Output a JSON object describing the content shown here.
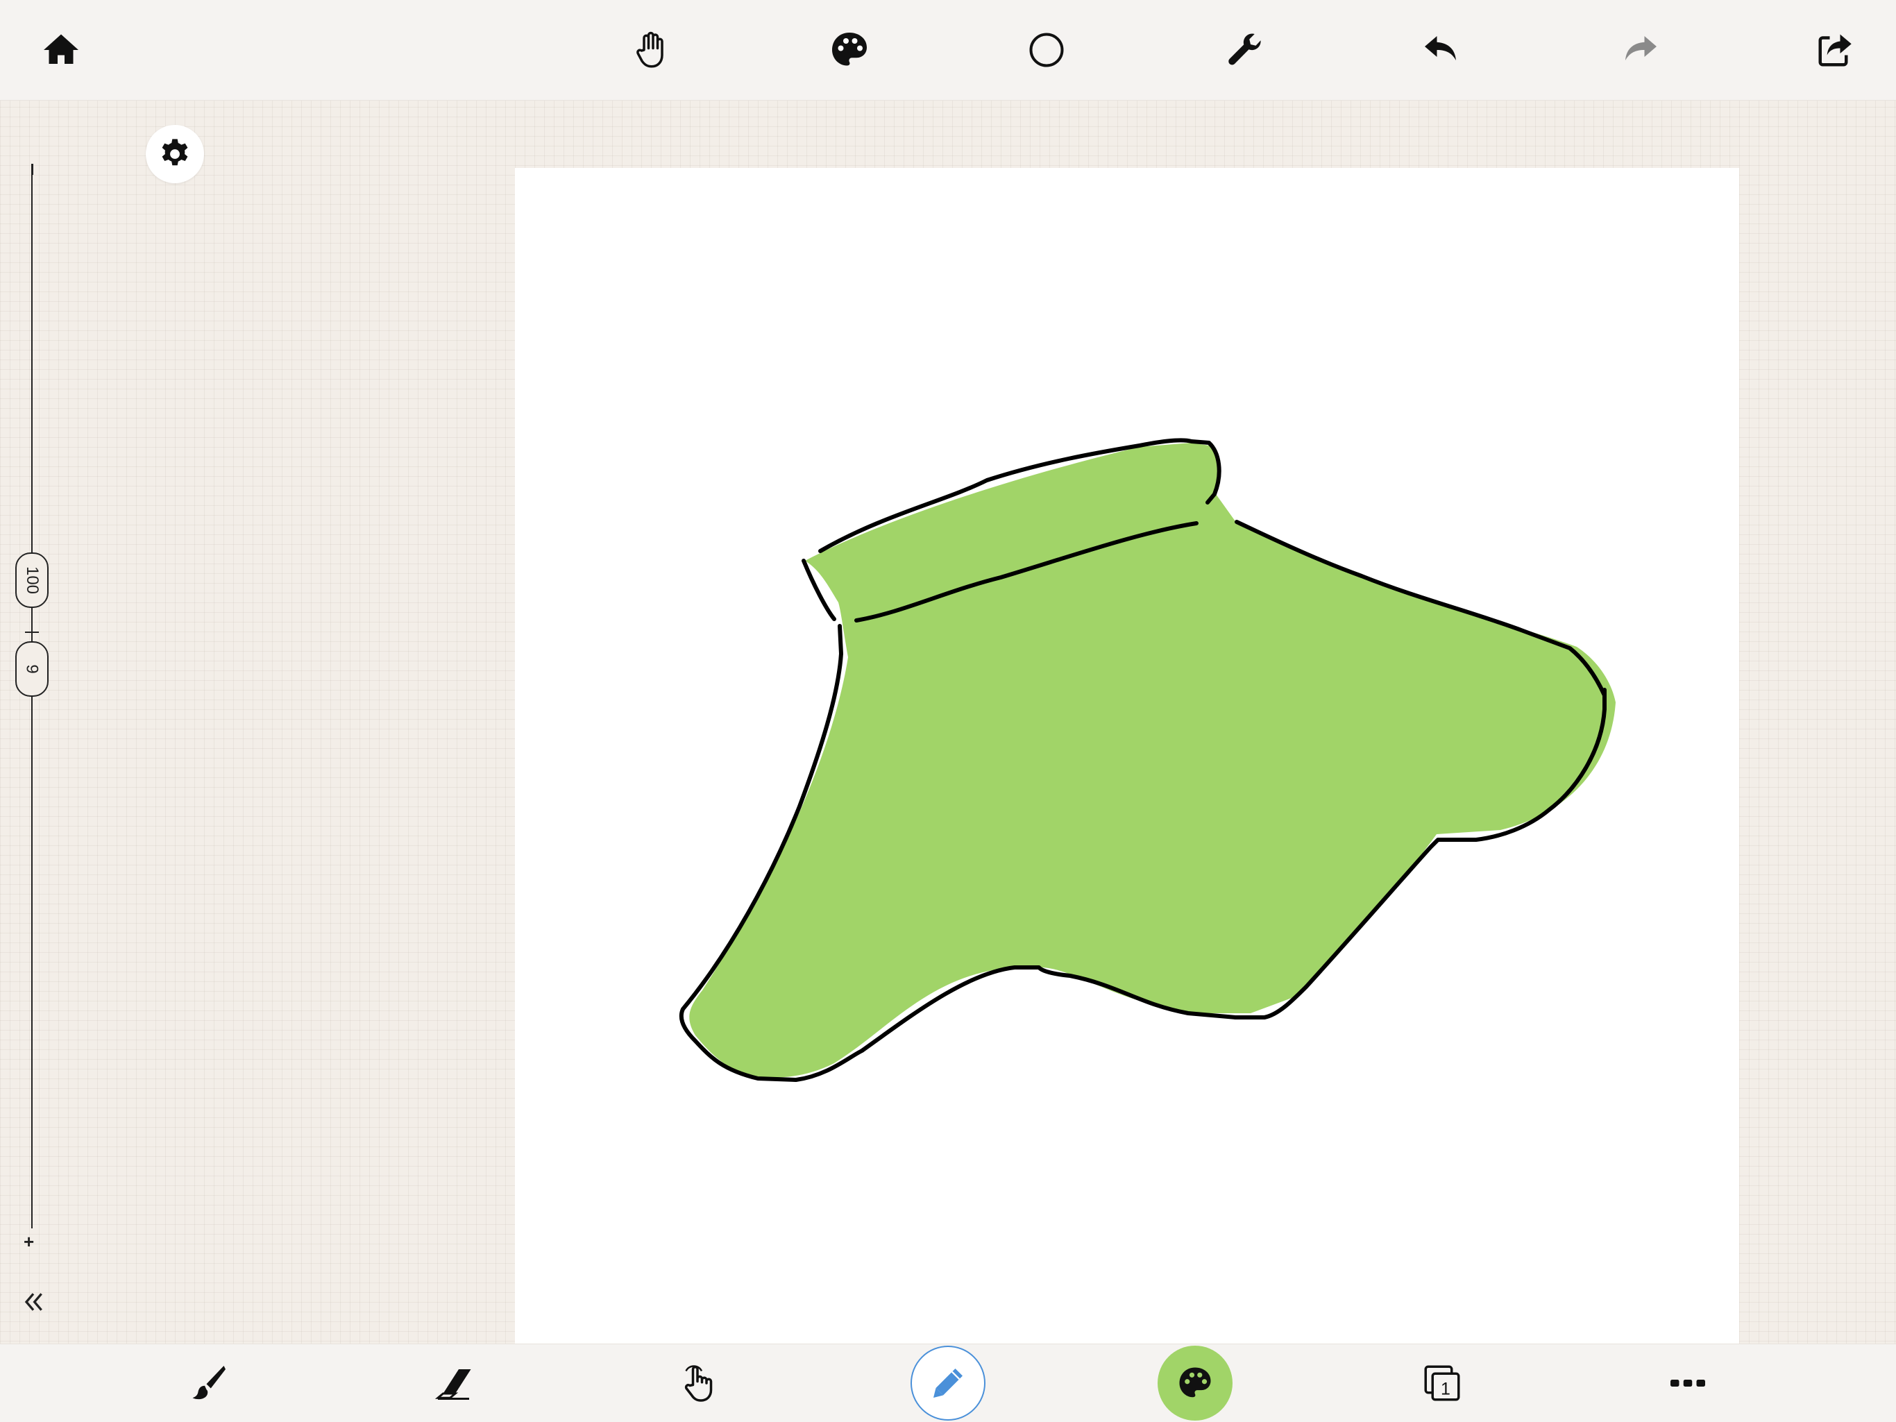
{
  "toolbar_top": {
    "icons": [
      "home-icon",
      "hand-icon",
      "palette-icon",
      "circle-icon",
      "wrench-icon",
      "undo-icon",
      "redo-icon",
      "share-icon"
    ]
  },
  "left_panel": {
    "size_value": "100",
    "opacity_value": "9",
    "slider_min_label": "–",
    "slider_max_label": "+"
  },
  "toolbar_bottom": {
    "icons": [
      "brush-icon",
      "eraser-icon",
      "touch-hand-icon",
      "pencil-icon",
      "palette-icon",
      "layers-icon",
      "more-icon"
    ],
    "layer_count": "1"
  },
  "colors": {
    "fill": "#a1d468",
    "stroke": "#000000",
    "pencil_accent": "#4a90d9"
  }
}
